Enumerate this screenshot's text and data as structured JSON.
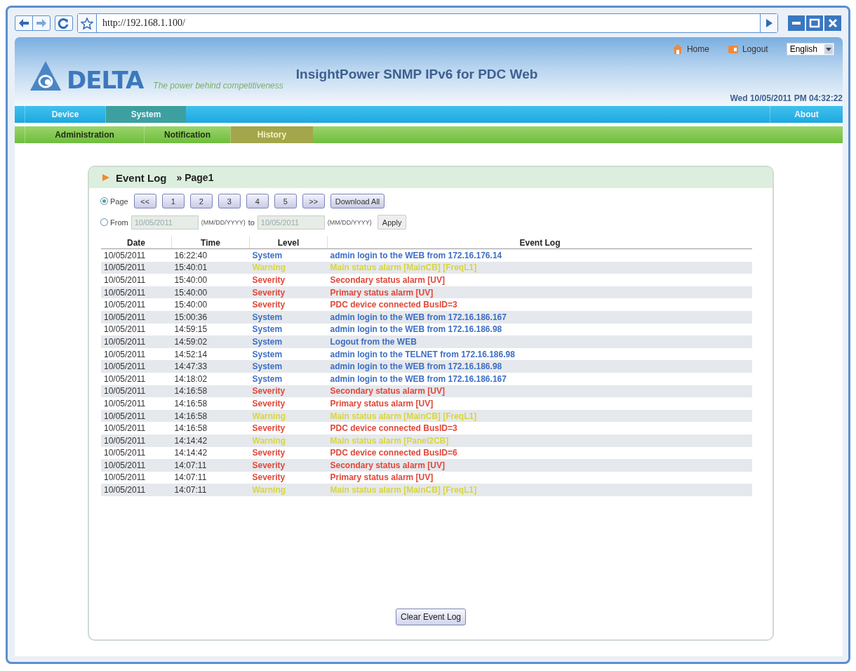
{
  "browser": {
    "url": "http://192.168.1.100/"
  },
  "header": {
    "logo": "DELTA",
    "tagline": "The power behind competitiveness",
    "title": "InsightPower SNMP IPv6 for PDC Web",
    "links": [
      "Home",
      "Logout"
    ],
    "language": "English",
    "datetime": "Wed 10/05/2011 PM 04:32:22"
  },
  "main_nav": [
    {
      "label": "Device",
      "selected": false
    },
    {
      "label": "System",
      "selected": true
    }
  ],
  "main_nav_right": "About",
  "sub_nav": [
    {
      "label": "Administration",
      "selected": false
    },
    {
      "label": "Notification",
      "selected": false
    },
    {
      "label": "History",
      "selected": true
    }
  ],
  "panel": {
    "title": "Event Log",
    "crumb": "» Page1",
    "page_option": {
      "label": "Page",
      "selected": true,
      "buttons": [
        "<<",
        "1",
        "2",
        "3",
        "4",
        "5",
        ">>",
        "Download All"
      ]
    },
    "range_option": {
      "label": "From",
      "selected": false,
      "from": "10/05/2011",
      "format_1": "(MM/DD/YYYY)",
      "to_label": "to",
      "to": "10/05/2011",
      "format_2": "(MM/DD/YYYY)",
      "apply": "Apply"
    },
    "table": {
      "columns": [
        "Date",
        "Time",
        "Level",
        "Event Log"
      ],
      "rows": [
        {
          "date": "10/05/2011",
          "time": "16:22:40",
          "level": "System",
          "kind": "system",
          "event": "admin login to the WEB from 172.16.176.14"
        },
        {
          "date": "10/05/2011",
          "time": "15:40:01",
          "level": "Warning",
          "kind": "warning",
          "event": "Main status alarm [MainCB] [FreqL1]"
        },
        {
          "date": "10/05/2011",
          "time": "15:40:00",
          "level": "Severity",
          "kind": "severity",
          "event": "Secondary status alarm [UV]"
        },
        {
          "date": "10/05/2011",
          "time": "15:40:00",
          "level": "Severity",
          "kind": "severity",
          "event": "Primary status alarm [UV]"
        },
        {
          "date": "10/05/2011",
          "time": "15:40:00",
          "level": "Severity",
          "kind": "severity",
          "event": "PDC device connected BusID=3"
        },
        {
          "date": "10/05/2011",
          "time": "15:00:36",
          "level": "System",
          "kind": "system",
          "event": "admin login to the WEB from 172.16.186.167"
        },
        {
          "date": "10/05/2011",
          "time": "14:59:15",
          "level": "System",
          "kind": "system",
          "event": "admin login to the WEB from 172.16.186.98"
        },
        {
          "date": "10/05/2011",
          "time": "14:59:02",
          "level": "System",
          "kind": "system",
          "event": "Logout from the WEB"
        },
        {
          "date": "10/05/2011",
          "time": "14:52:14",
          "level": "System",
          "kind": "system",
          "event": "admin login to the TELNET from 172.16.186.98"
        },
        {
          "date": "10/05/2011",
          "time": "14:47:33",
          "level": "System",
          "kind": "system",
          "event": "admin login to the WEB from 172.16.186.98"
        },
        {
          "date": "10/05/2011",
          "time": "14:18:02",
          "level": "System",
          "kind": "system",
          "event": "admin login to the WEB from 172.16.186.167"
        },
        {
          "date": "10/05/2011",
          "time": "14:16:58",
          "level": "Severity",
          "kind": "severity",
          "event": "Secondary status alarm [UV]"
        },
        {
          "date": "10/05/2011",
          "time": "14:16:58",
          "level": "Severity",
          "kind": "severity",
          "event": "Primary status alarm [UV]"
        },
        {
          "date": "10/05/2011",
          "time": "14:16:58",
          "level": "Warning",
          "kind": "warning",
          "event": "Main status alarm [MainCB] [FreqL1]"
        },
        {
          "date": "10/05/2011",
          "time": "14:16:58",
          "level": "Severity",
          "kind": "severity",
          "event": "PDC device connected BusID=3"
        },
        {
          "date": "10/05/2011",
          "time": "14:14:42",
          "level": "Warning",
          "kind": "warning",
          "event": "Main status alarm [Panel2CB]"
        },
        {
          "date": "10/05/2011",
          "time": "14:14:42",
          "level": "Severity",
          "kind": "severity",
          "event": "PDC device connected BusID=6"
        },
        {
          "date": "10/05/2011",
          "time": "14:07:11",
          "level": "Severity",
          "kind": "severity",
          "event": "Secondary status alarm [UV]"
        },
        {
          "date": "10/05/2011",
          "time": "14:07:11",
          "level": "Severity",
          "kind": "severity",
          "event": "Primary status alarm [UV]"
        },
        {
          "date": "10/05/2011",
          "time": "14:07:11",
          "level": "Warning",
          "kind": "warning",
          "event": "Main status alarm [MainCB] [FreqL1]"
        }
      ]
    },
    "clear_button": "Clear Event Log"
  }
}
